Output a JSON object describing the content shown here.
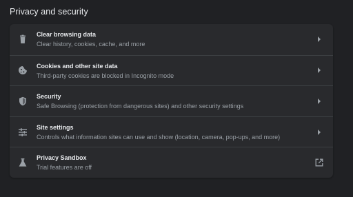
{
  "section": {
    "title": "Privacy and security"
  },
  "rows": [
    {
      "title": "Clear browsing data",
      "subtitle": "Clear history, cookies, cache, and more",
      "icon": "trash-icon",
      "action_icon": "chevron-right-icon"
    },
    {
      "title": "Cookies and other site data",
      "subtitle": "Third-party cookies are blocked in Incognito mode",
      "icon": "cookie-icon",
      "action_icon": "chevron-right-icon"
    },
    {
      "title": "Security",
      "subtitle": "Safe Browsing (protection from dangerous sites) and other security settings",
      "icon": "shield-icon",
      "action_icon": "chevron-right-icon"
    },
    {
      "title": "Site settings",
      "subtitle": "Controls what information sites can use and show (location, camera, pop-ups, and more)",
      "icon": "sliders-icon",
      "action_icon": "chevron-right-icon"
    },
    {
      "title": "Privacy Sandbox",
      "subtitle": "Trial features are off",
      "icon": "flask-icon",
      "action_icon": "open-in-new-icon"
    }
  ],
  "colors": {
    "background": "#202124",
    "card": "#292a2d",
    "divider": "#3c4043",
    "text_primary": "#e8eaed",
    "text_secondary": "#9aa0a6",
    "icon": "#9aa0a6"
  }
}
